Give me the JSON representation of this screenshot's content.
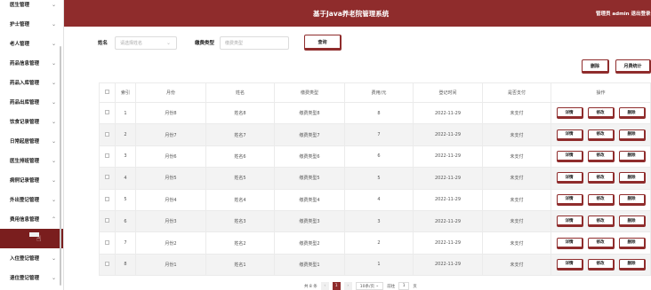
{
  "header": {
    "title": "基于Java养老院管理系统",
    "user_text": "管理员 admin  退出登录"
  },
  "sidebar": {
    "items": [
      {
        "label": "医生管理",
        "chevron": "⌄"
      },
      {
        "label": "护士管理",
        "chevron": "⌄"
      },
      {
        "label": "老人管理",
        "chevron": "⌄"
      },
      {
        "label": "药品信息管理",
        "chevron": "⌄"
      },
      {
        "label": "药品入库管理",
        "chevron": "⌄"
      },
      {
        "label": "药品出库管理",
        "chevron": "⌄"
      },
      {
        "label": "饮食记录管理",
        "chevron": "⌄"
      },
      {
        "label": "日常起居管理",
        "chevron": "⌄"
      },
      {
        "label": "医生排班管理",
        "chevron": "⌄"
      },
      {
        "label": "病例记录管理",
        "chevron": "⌄"
      },
      {
        "label": "外出登记管理",
        "chevron": "⌄"
      },
      {
        "label": "费用信息管理",
        "chevron": "⌃"
      },
      {
        "label": "入住登记管理",
        "chevron": "⌄"
      },
      {
        "label": "退住登记管理",
        "chevron": "⌄"
      }
    ]
  },
  "search": {
    "name_label": "姓名",
    "name_placeholder": "请选择姓名",
    "type_label": "缴费类型",
    "type_placeholder": "缴费类型",
    "query_button": "查询"
  },
  "actions": {
    "delete_button": "删除",
    "monthly_stats_button": "月费统计"
  },
  "table": {
    "headers": [
      "索引",
      "月份",
      "姓名",
      "缴费类型",
      "费用/元",
      "登记时间",
      "是否支付",
      "操作"
    ],
    "op_labels": {
      "detail": "详情",
      "edit": "修改",
      "delete": "删除"
    },
    "rows": [
      {
        "index": "1",
        "month": "月份8",
        "name": "姓名8",
        "type": "缴费类型8",
        "fee": "8",
        "date": "2022-11-29",
        "paid": "未支付"
      },
      {
        "index": "2",
        "month": "月份7",
        "name": "姓名7",
        "type": "缴费类型7",
        "fee": "7",
        "date": "2022-11-29",
        "paid": "未支付"
      },
      {
        "index": "3",
        "month": "月份6",
        "name": "姓名6",
        "type": "缴费类型6",
        "fee": "6",
        "date": "2022-11-29",
        "paid": "未支付"
      },
      {
        "index": "4",
        "month": "月份5",
        "name": "姓名5",
        "type": "缴费类型5",
        "fee": "5",
        "date": "2022-11-29",
        "paid": "未支付"
      },
      {
        "index": "5",
        "month": "月份4",
        "name": "姓名4",
        "type": "缴费类型4",
        "fee": "4",
        "date": "2022-11-29",
        "paid": "未支付"
      },
      {
        "index": "6",
        "month": "月份3",
        "name": "姓名3",
        "type": "缴费类型3",
        "fee": "3",
        "date": "2022-11-29",
        "paid": "未支付"
      },
      {
        "index": "7",
        "month": "月份2",
        "name": "姓名2",
        "type": "缴费类型2",
        "fee": "2",
        "date": "2022-11-29",
        "paid": "未支付"
      },
      {
        "index": "8",
        "month": "月份1",
        "name": "姓名1",
        "type": "缴费类型1",
        "fee": "1",
        "date": "2022-11-29",
        "paid": "未支付"
      }
    ]
  },
  "pager": {
    "total": "共 8 条",
    "prev": "‹",
    "current": "1",
    "next": "›",
    "page_size": "10条/页",
    "goto_label": "前往",
    "goto_value": "1",
    "page_unit": "页"
  },
  "colors": {
    "brand": "#8f2c2c",
    "row_stripe": "#f3f3f3"
  }
}
